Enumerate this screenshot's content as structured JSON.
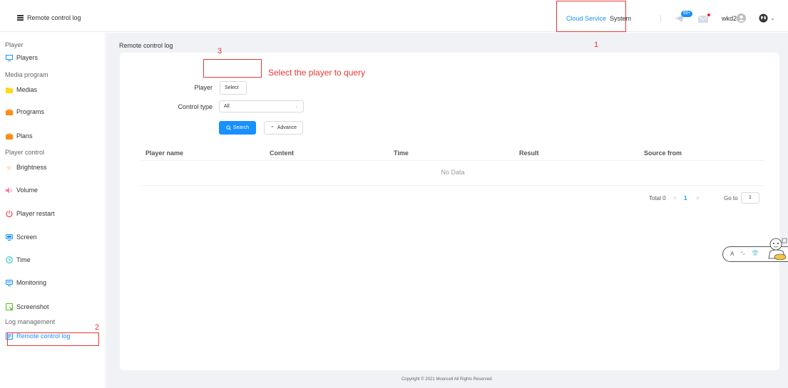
{
  "header": {
    "menu_icon": "hamburger-icon",
    "title": "Remote control log",
    "nav": {
      "cloud_service": "Cloud Service",
      "system": "System"
    },
    "notification_badge": "99+",
    "username": "wkd2",
    "icons": [
      "paper-plane-icon",
      "mail-icon",
      "avatar-icon",
      "globe-icon",
      "chevron-down-icon"
    ],
    "colors": {
      "accent": "#1890ff",
      "badge": "#1890ff",
      "alert_dot": "#f5222d"
    }
  },
  "sidebar": {
    "groups": {
      "player": "Player",
      "media_program": "Media program",
      "player_control": "Player control",
      "log_management": "Log management"
    },
    "items": {
      "players": "Players",
      "medias": "Medias",
      "programs": "Programs",
      "plans": "Plans",
      "brightness": "Brightness",
      "volume": "Volume",
      "player_restart": "Player restart",
      "screen": "Screen",
      "time": "Time",
      "monitoring": "Monitoring",
      "screenshot": "Screenshot",
      "remote_control_log": "Remote control log"
    },
    "active_item": "remote_control_log"
  },
  "main": {
    "breadcrumb": "Remote control log",
    "form": {
      "player_label": "Player",
      "player_button": "Select",
      "control_type_label": "Control type",
      "control_type_value": "All",
      "search_button": "Search",
      "advance_button": "Advance"
    },
    "table": {
      "columns": [
        "Player name",
        "Content",
        "Time",
        "Result",
        "Source from"
      ],
      "empty_text": "No Data"
    },
    "pagination": {
      "total": "Total 0",
      "prev": "<",
      "current_page": "1",
      "next": ">",
      "goto_label": "Go to",
      "goto_value": "1"
    },
    "footer": "Copyright © 2021 Mooncell All Rights Reserved."
  },
  "annotations": {
    "step1": "1",
    "step2": "2",
    "step3": "3",
    "select_hint": "Select the player to query",
    "color": "#e53935"
  },
  "widget": {
    "letter": "A",
    "dots": "⁺⸴",
    "icon": "shirt-icon"
  }
}
